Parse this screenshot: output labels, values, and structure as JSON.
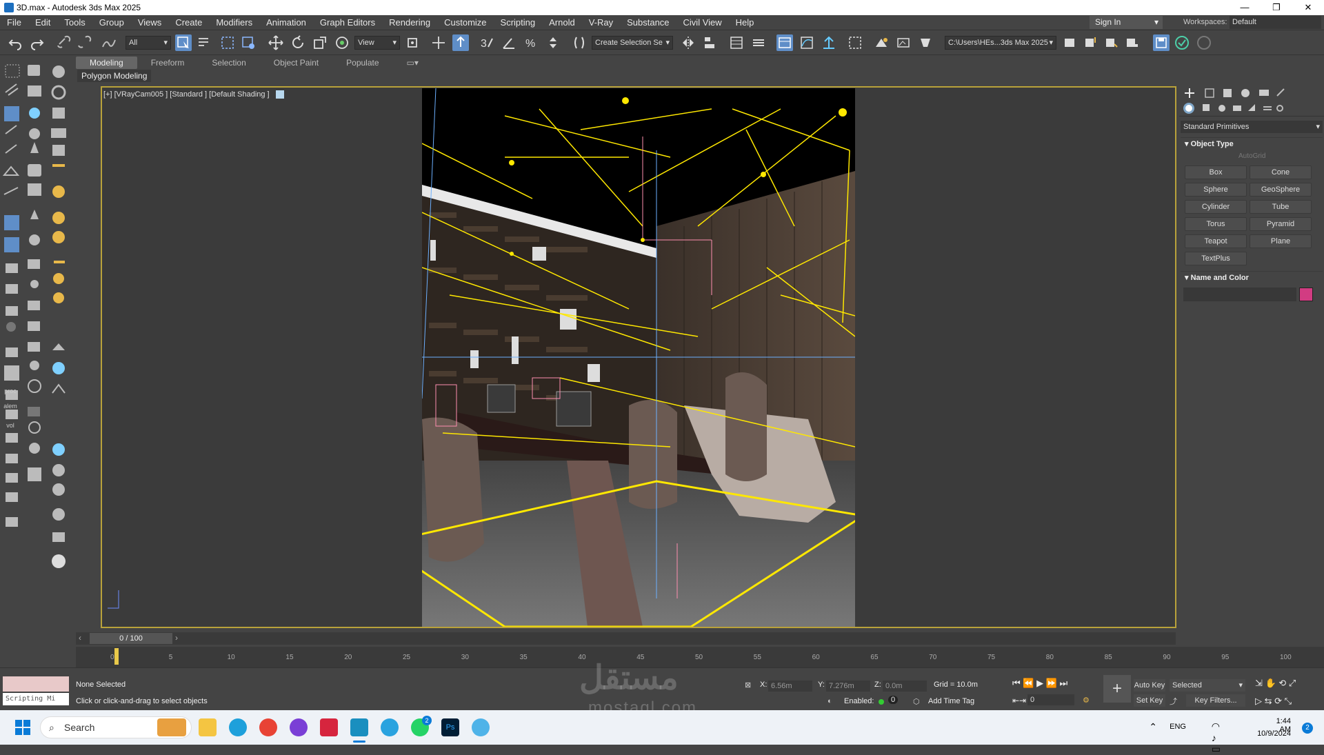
{
  "window": {
    "title": "3D.max - Autodesk 3ds Max 2025",
    "minimize": "—",
    "maximize": "❐",
    "close": "✕"
  },
  "menu": [
    "File",
    "Edit",
    "Tools",
    "Group",
    "Views",
    "Create",
    "Modifiers",
    "Animation",
    "Graph Editors",
    "Rendering",
    "Customize",
    "Scripting",
    "Arnold",
    "V-Ray",
    "Substance",
    "Civil View",
    "Help"
  ],
  "account": {
    "signin": "Sign In",
    "workspaces_label": "Workspaces:",
    "workspace": "Default"
  },
  "toolbar": {
    "selection_filter": "All",
    "ref_coord": "View",
    "named_selection": "Create Selection Se",
    "project_path": "C:\\Users\\HEs...3ds Max 2025"
  },
  "ribbon": {
    "tabs": [
      "Modeling",
      "Freeform",
      "Selection",
      "Object Paint",
      "Populate"
    ],
    "active_tab": "Modeling",
    "sub": "Polygon Modeling"
  },
  "viewport": {
    "label": "[+] [VRayCam005 ] [Standard ] [Default Shading ]"
  },
  "command_panel": {
    "category": "Standard Primitives",
    "object_type_title": "Object Type",
    "autogrid": "AutoGrid",
    "buttons": [
      "Box",
      "Cone",
      "Sphere",
      "GeoSphere",
      "Cylinder",
      "Tube",
      "Torus",
      "Pyramid",
      "Teapot",
      "Plane",
      "TextPlus"
    ],
    "name_color_title": "Name and Color",
    "color": "#d23c82"
  },
  "timeline": {
    "frame": "0 / 100",
    "ticks": [
      "0",
      "5",
      "10",
      "15",
      "20",
      "25",
      "30",
      "35",
      "40",
      "45",
      "50",
      "55",
      "60",
      "65",
      "70",
      "75",
      "80",
      "85",
      "90",
      "95",
      "100"
    ]
  },
  "status": {
    "selection": "None Selected",
    "prompt": "Click or click-and-drag to select objects",
    "script": "Scripting Mi",
    "x_label": "X:",
    "x": "6.56m",
    "y_label": "Y:",
    "y": "7.276m",
    "z_label": "Z:",
    "z": "0.0m",
    "grid": "Grid = 10.0m",
    "enabled": "Enabled:",
    "add_time_tag": "Add Time Tag",
    "frame_field": "0",
    "auto_key": "Auto Key",
    "set_key": "Set Key",
    "selected": "Selected",
    "key_filters": "Key Filters..."
  },
  "taskbar": {
    "search": "Search",
    "lang": "ENG",
    "time": "1:44 AM",
    "date": "10/9/2024",
    "badge": "2",
    "whatsapp_badge": "2"
  },
  "watermark": {
    "arabic": "مستقل",
    "latin": "mostaql.com"
  }
}
